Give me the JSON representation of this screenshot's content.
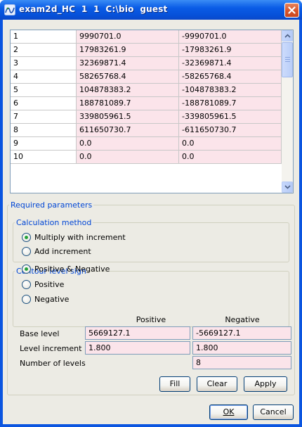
{
  "window": {
    "title": "exam2d_HC  1  1  C:\\bio  guest"
  },
  "table": {
    "rows": [
      {
        "index": "1",
        "positive": "9990701.0",
        "negative": "-9990701.0"
      },
      {
        "index": "2",
        "positive": "17983261.9",
        "negative": "-17983261.9"
      },
      {
        "index": "3",
        "positive": "32369871.4",
        "negative": "-32369871.4"
      },
      {
        "index": "4",
        "positive": "58265768.4",
        "negative": "-58265768.4"
      },
      {
        "index": "5",
        "positive": "104878383.2",
        "negative": "-104878383.2"
      },
      {
        "index": "6",
        "positive": "188781089.7",
        "negative": "-188781089.7"
      },
      {
        "index": "7",
        "positive": "339805961.5",
        "negative": "-339805961.5"
      },
      {
        "index": "8",
        "positive": "611650730.7",
        "negative": "-611650730.7"
      },
      {
        "index": "9",
        "positive": "0.0",
        "negative": "0.0"
      },
      {
        "index": "10",
        "positive": "0.0",
        "negative": "0.0"
      }
    ]
  },
  "required": {
    "legend": "Required parameters",
    "calc": {
      "legend": "Calculation method",
      "options": [
        "Multiply with increment",
        "Add increment"
      ],
      "selected": 0
    },
    "sign": {
      "legend": "Contour level sign",
      "options": [
        "Positive & Negative",
        "Positive",
        "Negative"
      ],
      "selected": 0
    },
    "params": {
      "header_positive": "Positive",
      "header_negative": "Negative",
      "base_label": "Base level",
      "base_positive": "5669127.1",
      "base_negative": "-5669127.1",
      "increment_label": "Level increment",
      "increment_positive": "1.800",
      "increment_negative": "1.800",
      "levels_label": "Number of levels",
      "levels_value": "8"
    },
    "buttons": {
      "fill": "Fill",
      "clear": "Clear",
      "apply": "Apply"
    }
  },
  "footer": {
    "ok": "OK",
    "cancel": "Cancel"
  },
  "colors": {
    "title_blue": "#0a5ce6",
    "legend_blue": "#0046d5",
    "field_pink": "#fbe4ea",
    "radio_green": "#26a23a"
  }
}
